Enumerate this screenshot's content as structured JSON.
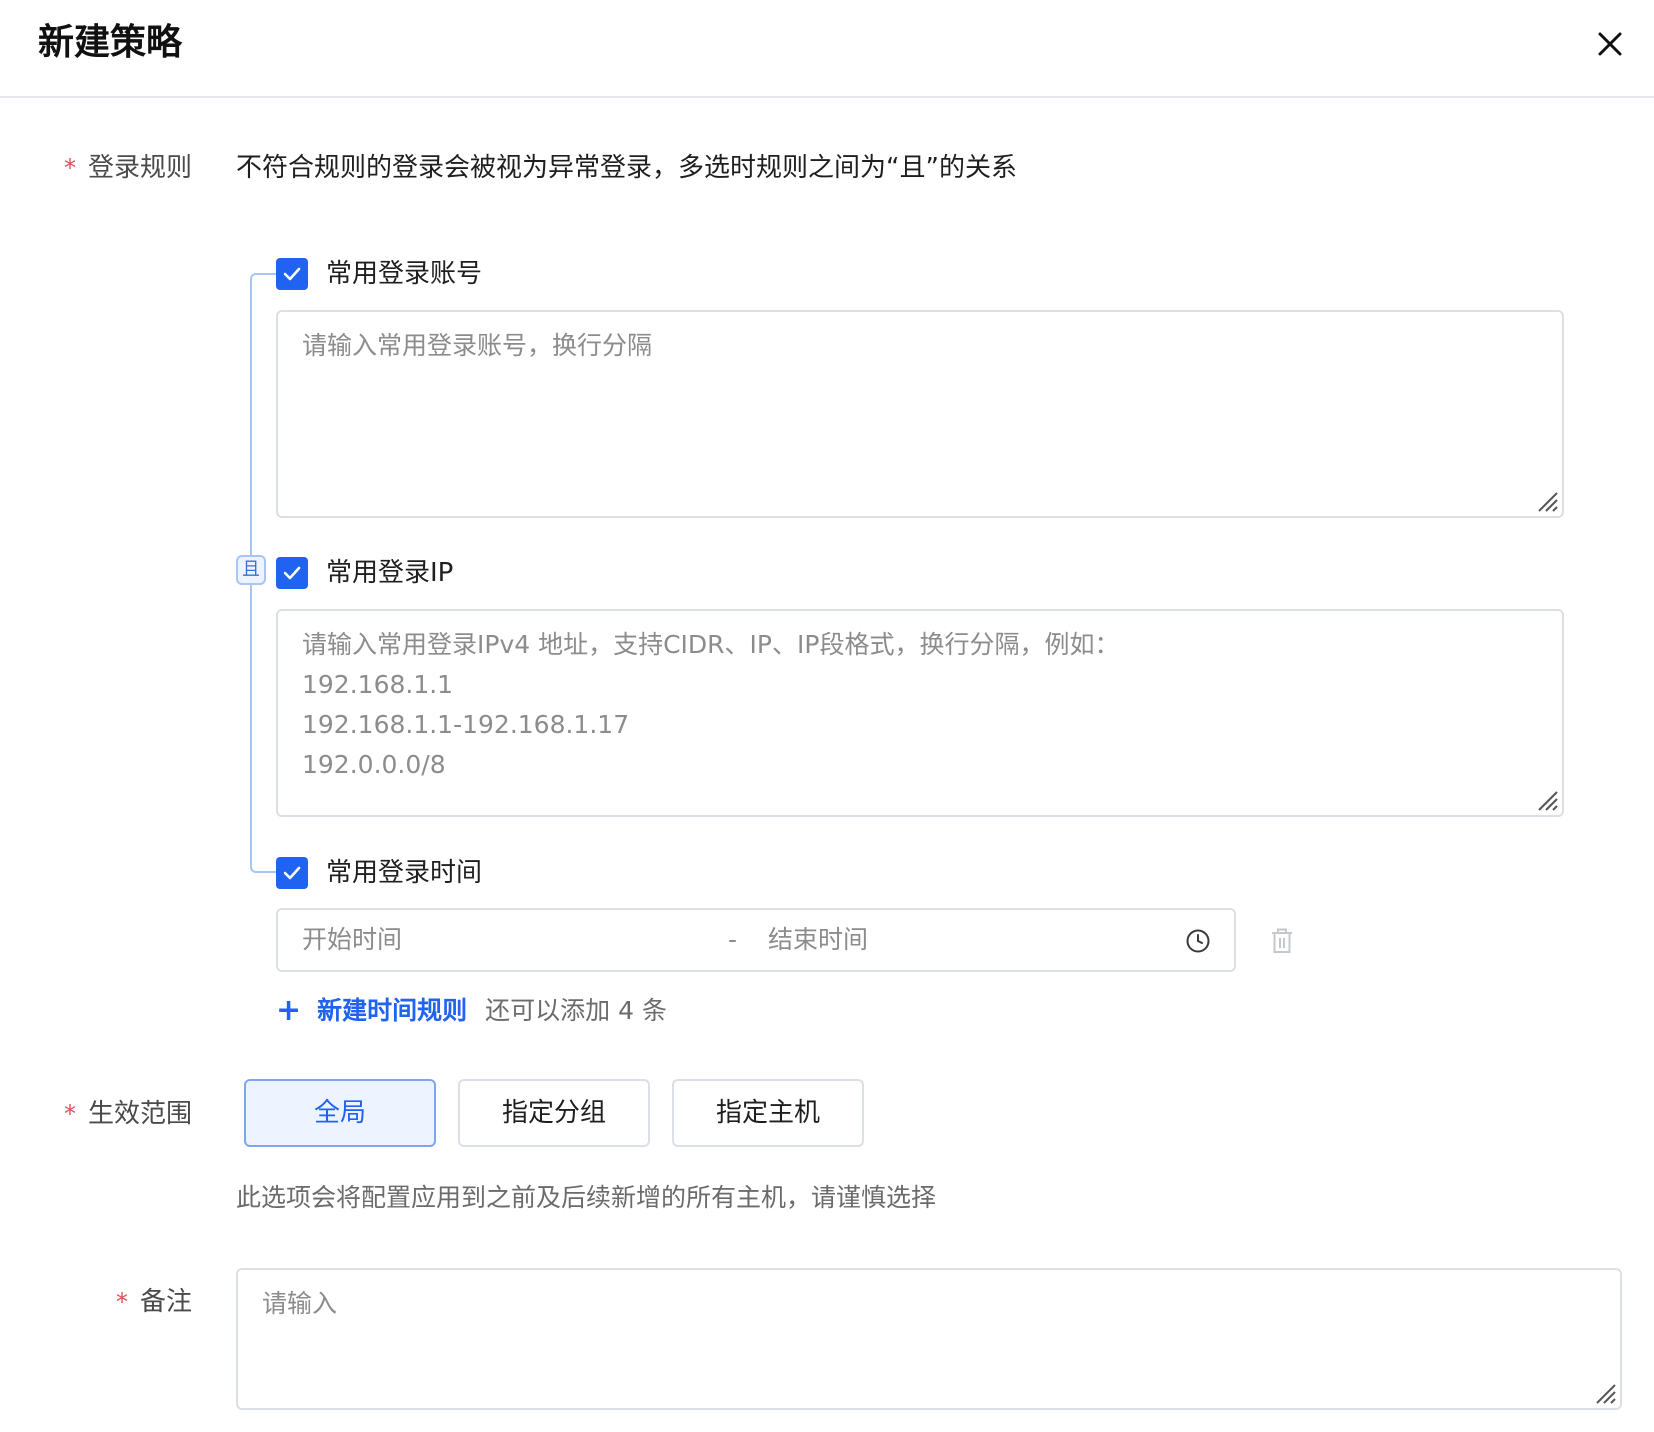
{
  "dialog": {
    "title": "新建策略",
    "close_icon": "close-icon"
  },
  "login_rules": {
    "required_mark": "*",
    "label": "登录规则",
    "description": "不符合规则的登录会被视为异常登录，多选时规则之间为“且”的关系",
    "and_badge": "且",
    "account": {
      "checked": true,
      "label": "常用登录账号",
      "placeholder": "请输入常用登录账号，换行分隔"
    },
    "ip": {
      "checked": true,
      "label": "常用登录IP",
      "placeholder": "请输入常用登录IPv4 地址，支持CIDR、IP、IP段格式，换行分隔，例如：\n192.168.1.1\n192.168.1.1-192.168.1.17\n192.0.0.0/8"
    },
    "time": {
      "checked": true,
      "label": "常用登录时间",
      "start_placeholder": "开始时间",
      "separator": "-",
      "end_placeholder": "结束时间",
      "clock_icon": "clock-icon",
      "delete_icon": "trash-icon"
    },
    "add_time_rule": {
      "plus": "+",
      "label": "新建时间规则",
      "remaining": "还可以添加 4 条"
    }
  },
  "scope": {
    "required_mark": "*",
    "label": "生效范围",
    "options": [
      "全局",
      "指定分组",
      "指定主机"
    ],
    "selected": "全局",
    "hint": "此选项会将配置应用到之前及后续新增的所有主机，请谨慎选择"
  },
  "remark": {
    "required_mark": "*",
    "label": "备注",
    "placeholder": "请输入"
  },
  "colors": {
    "primary": "#1f63f0",
    "required": "#e34d59",
    "border": "#dcdfe6",
    "active_bg": "#eef4ff"
  }
}
